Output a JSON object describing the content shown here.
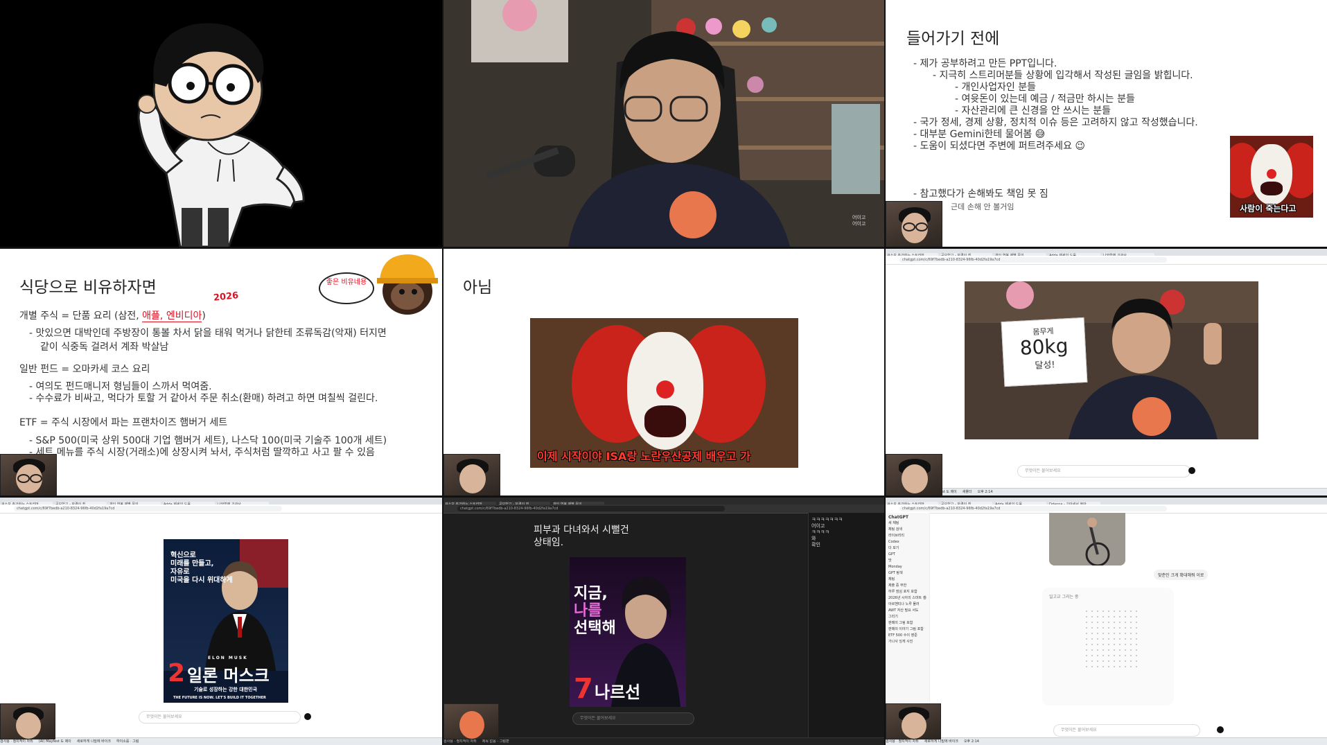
{
  "tiles": {
    "slide_intro": {
      "title": "들어가기 전에",
      "bullets": [
        {
          "level": 0,
          "text": "제가 공부하려고 만든 PPT입니다."
        },
        {
          "level": 1,
          "text": "지극히 스트리머분들 상황에 입각해서 작성된 글임을 밝힙니다."
        },
        {
          "level": 2,
          "text": "개인사업자인 분들"
        },
        {
          "level": 2,
          "text": "여윳돈이 있는데 예금 / 적금만 하시는 분들"
        },
        {
          "level": 2,
          "text": "자산관리에 큰 신경을 안 쓰시는 분들"
        },
        {
          "level": 0,
          "text": "국가 정세, 경제 상황, 정치적 이슈 등은 고려하지 않고 작성했습니다."
        },
        {
          "level": 0,
          "text": "대부분 Gemini한테 물어봄 😅"
        },
        {
          "level": 0,
          "text": "도움이 되셨다면 주변에 퍼트려주세요 😉"
        }
      ],
      "disclaimer": "참고했다가 손해봐도 책임 못 짐",
      "disclaimer_sub": "근데 손해 안 볼거임",
      "meme_caption": "사람이 죽는다고"
    },
    "slide_restaurant": {
      "title": "식당으로 비유하자면",
      "annotation_year": "2026",
      "speech_bubble": "좋은 비유네용",
      "line1_prefix": "개별 주식 = 단품 요리 (삼전, ",
      "line1_highlight": "애플, 엔비디아",
      "line1_suffix": ")",
      "sub1": "맛있으면 대박인데 주방장이 통볼 차서 닭을 태워 먹거나 닭한테 조류독감(악재) 터지면",
      "sub1b": "같이 식중독 걸려서 계좌 박살남",
      "line2": "일반 펀드 = 오마카세 코스 요리",
      "sub2a": "여의도 펀드매니저 형님들이 스까서 먹여줌.",
      "sub2b": "수수료가 비싸고, 먹다가 토할 거 같아서 주문 취소(환매) 하려고 하면 며칠씩 걸린다.",
      "line3": "ETF = 주식 시장에서 파는 프랜차이즈 햄버거 세트",
      "sub3a": "S&P 500(미국 상위 500대 기업 햄버거 세트), 나스닥 100(미국 기술주 100개 세트)",
      "sub3b": "세트 메뉴를 주식 시장(거래소)에 상장시켜 놔서, 주식처럼 딸깍하고 사고 팔 수 있음"
    },
    "slide_no": {
      "title": "아님",
      "caption": "이제 시작이야 ISA랑 노란우산공제 배우고 가"
    },
    "weight_sign": {
      "line1": "몸무게",
      "line2": "80kg",
      "line3": "달성!"
    },
    "poster_musk": {
      "tagline1": "혁신으로",
      "tagline2": "미래를 만들고,",
      "tagline3": "자유로",
      "tagline4": "미국을 다시 위대하게",
      "name_small": "ELON MUSK",
      "big_num": "2",
      "big_name": "일론 머스크",
      "sub": "기술로 성장하는 강한 대한민국",
      "footer": "THE FUTURE IS NOW. LET'S BUILD IT TOGETHER"
    },
    "poster_choice": {
      "overlay": "피부과 다녀와서 시뻘건 상태임.",
      "line1": "지금,",
      "line2": "나를",
      "line3": "선택해",
      "big_num": "7",
      "big_name": "나르선"
    },
    "chatgpt": {
      "brand": "ChatGPT",
      "user_bubble": "맞춘인 크게 확대해줘 이로",
      "loading": "일고교 그리는 중",
      "sidebar_items": [
        "새 채팅",
        "채팅 검색",
        "라이브러리",
        "Codex",
        "더 보기",
        "GPT",
        "맛",
        "Monday",
        "GPT 탐색",
        "채팅",
        "제출 중 무한",
        "하루 점심 포지 포함",
        "2026년 시아의 스마트 셀러",
        "아르헨티나 노루 물러",
        "AWT 자산 필요 서도",
        "그리기",
        "판매의 그림 포함",
        "판매의 이야기 그림 포함",
        "ETF 500 수이 영준",
        "가나사 잉게 사진"
      ]
    }
  },
  "browser": {
    "tabs": [
      "검소보 추가하는 스트리머",
      "공보험고 - 자격이 최",
      "개인 연봉 제별 문의",
      "Adda 제세의 도움",
      "나와함께 기관사",
      "Ddanna - 기아세서 정아"
    ],
    "url": "chatgpt.com/c/69f7bedb-a210-8324-96fb-40d2fa19a7cd",
    "prompt_placeholder": "무엇이든 물어보세요",
    "taskbar_items": [
      "검사용 · 정치적이 자취",
      "(Al) Mayfest 도 제이",
      "새폴더",
      "새로하게 나밑에 바이크",
      "하이소를 · 그림",
      "제목 없음 - 그림판"
    ],
    "clock": "오후 2:14"
  },
  "chat_overlay": {
    "lines": [
      "ㅋㅋㅋㅋㅋㅋㅋ",
      "어이고",
      "어이고",
      "ㅋㅋㅋㅋ",
      "와",
      "확인"
    ]
  },
  "colors": {
    "accent_red": "#d12222",
    "clown_red": "#c9231b",
    "caption_red": "#ff3b2f",
    "slide_bg": "#ffffff",
    "dark_bg": "#000000"
  }
}
